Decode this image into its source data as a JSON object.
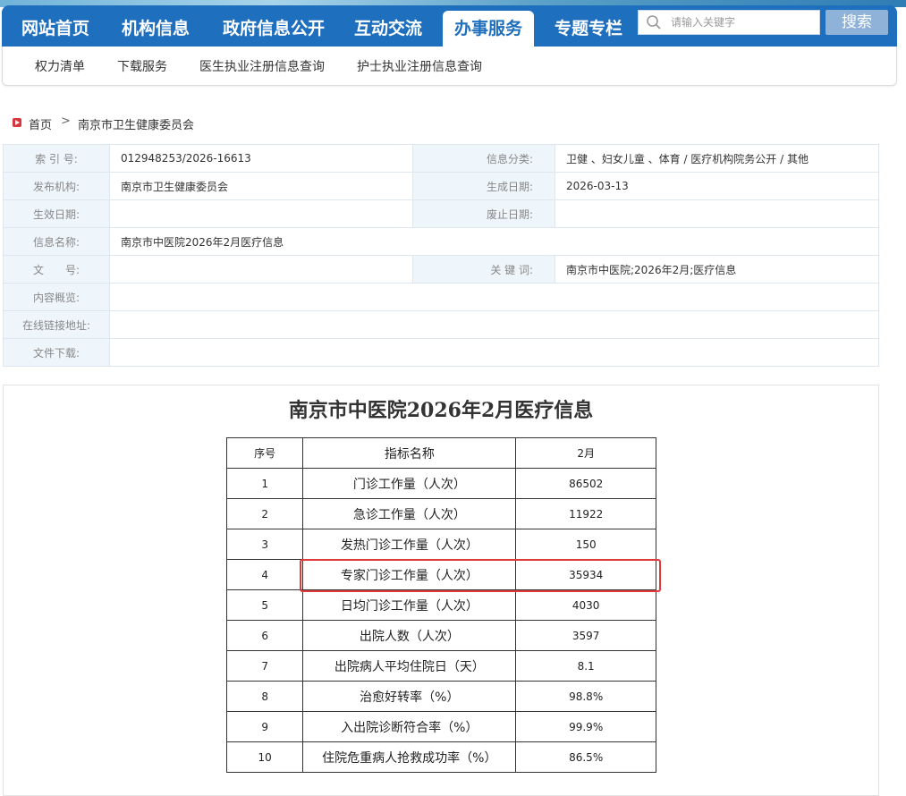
{
  "nav": {
    "items": [
      "网站首页",
      "机构信息",
      "政府信息公开",
      "互动交流",
      "办事服务",
      "专题专栏"
    ],
    "active_index": 4,
    "search_placeholder": "请输入关键字",
    "search_button": "搜索"
  },
  "subnav": {
    "items": [
      "权力清单",
      "下载服务",
      "医生执业注册信息查询",
      "护士执业注册信息查询"
    ]
  },
  "breadcrumb": {
    "home": "首页",
    "separator": ">",
    "current": "南京市卫生健康委员会"
  },
  "meta": {
    "index_label": "索 引 号:",
    "index_value": "012948253/2026-16613",
    "category_label": "信息分类:",
    "category_value": "卫健 、妇女儿童 、体育 / 医疗机构院务公开 / 其他",
    "publisher_label": "发布机构:",
    "publisher_value": "南京市卫生健康委员会",
    "generated_label": "生成日期:",
    "generated_value": "2026-03-13",
    "effective_label": "生效日期:",
    "effective_value": "",
    "expire_label": "废止日期:",
    "expire_value": "",
    "name_label": "信息名称:",
    "name_value": "南京市中医院2026年2月医疗信息",
    "docno_label": "文　　号:",
    "docno_value": "",
    "keywords_label": "关 键 词:",
    "keywords_value": "南京市中医院;2026年2月;医疗信息",
    "summary_label": "内容概览:",
    "summary_value": "",
    "link_label": "在线链接地址:",
    "link_value": "",
    "download_label": "文件下载:",
    "download_value": ""
  },
  "article": {
    "title": "南京市中医院2026年2月医疗信息",
    "headers": [
      "序号",
      "指标名称",
      "2月"
    ],
    "rows": [
      [
        "1",
        "门诊工作量（人次）",
        "86502"
      ],
      [
        "2",
        "急诊工作量（人次）",
        "11922"
      ],
      [
        "3",
        "发热门诊工作量（人次）",
        "150"
      ],
      [
        "4",
        "专家门诊工作量（人次）",
        "35934"
      ],
      [
        "5",
        "日均门诊工作量（人次）",
        "4030"
      ],
      [
        "6",
        "出院人数（人次）",
        "3597"
      ],
      [
        "7",
        "出院病人平均住院日（天）",
        "8.1"
      ],
      [
        "8",
        "治愈好转率（%）",
        "98.8%"
      ],
      [
        "9",
        "入出院诊断符合率（%）",
        "99.9%"
      ],
      [
        "10",
        "住院危重病人抢救成功率（%）",
        "86.5%"
      ]
    ],
    "highlighted_row": 4,
    "highlight_color": "#e03a3a"
  },
  "colors": {
    "nav_bg": "#1f6fbf",
    "meta_label_bg": "#eef5fb"
  }
}
